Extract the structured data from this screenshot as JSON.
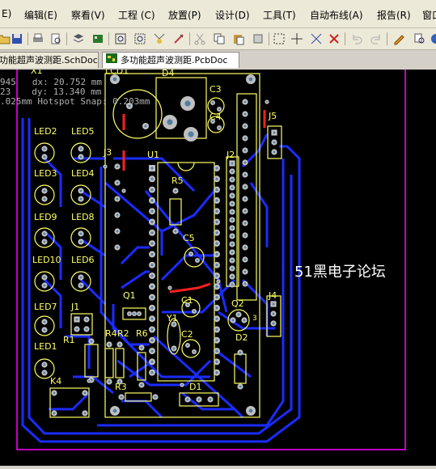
{
  "menu": [
    {
      "label": "E)"
    },
    {
      "label": "编辑(E)"
    },
    {
      "label": "察看(V)"
    },
    {
      "label": "工程 (C)"
    },
    {
      "label": "放置(P)"
    },
    {
      "label": "设计(D)"
    },
    {
      "label": "工具(T)"
    },
    {
      "label": "自动布线(A)"
    },
    {
      "label": "报告(R)"
    },
    {
      "label": "窗口"
    }
  ],
  "tabs": [
    {
      "label": "功能超声波测距.SchDoc",
      "active": false
    },
    {
      "label": "多功能超声波测距.PcbDoc",
      "active": true
    }
  ],
  "hud": {
    "line1_left": "945",
    "line1_right": "dx: 20.752 mm",
    "line2_left": "23",
    "line2_right": "dy: 13.340 mm",
    "line3": ".025mm Hotspot Snap: 0.203mm"
  },
  "watermark": "51黑电子论坛",
  "colors": {
    "board_bg": "#000000",
    "outline": "#ffff66",
    "bottom_copper": "#1a2cff",
    "top_copper": "#ff2020",
    "board_edge": "#ff00ff",
    "pad": "#c0c0c0"
  },
  "components": {
    "leds": [
      "LED2",
      "LED5",
      "LED3",
      "LED4",
      "LED9",
      "LED8",
      "LED10",
      "LED6",
      "LED7",
      "LED1"
    ],
    "others": [
      "U1",
      "U4",
      "J1",
      "J2",
      "J3",
      "J4",
      "J5",
      "C1",
      "C2",
      "C3",
      "C4",
      "C5",
      "Q1",
      "Q2",
      "D1",
      "D2",
      "R1",
      "R2",
      "R3",
      "R4",
      "R5",
      "R6",
      "Y1",
      "K4",
      "LCD1",
      "X1"
    ]
  }
}
